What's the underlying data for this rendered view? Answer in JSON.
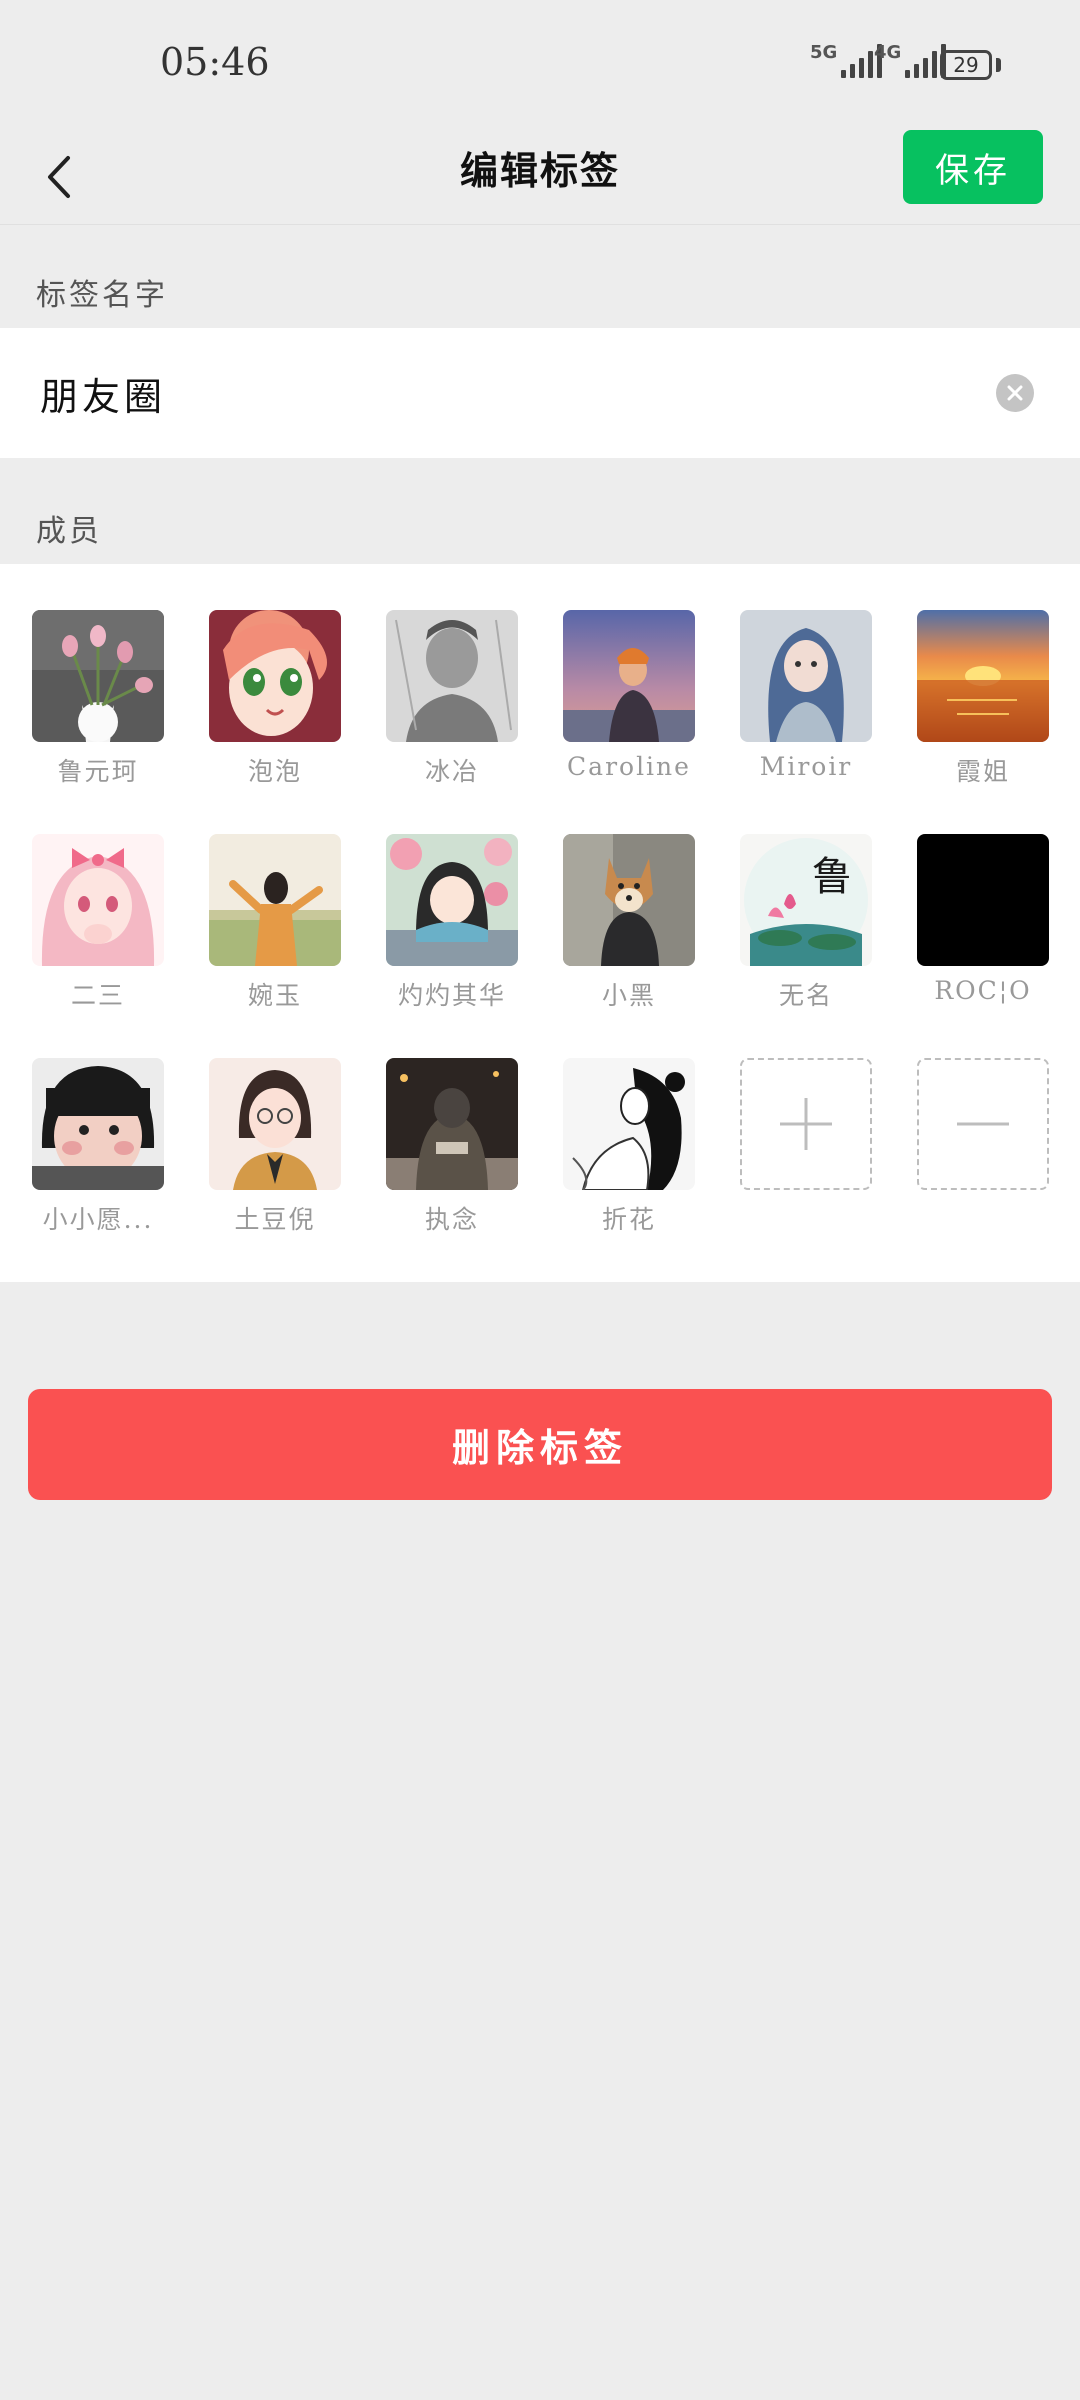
{
  "status_bar": {
    "time": "05:46",
    "sig1": "5G",
    "sig2": "4G",
    "battery": "29"
  },
  "nav": {
    "title": "编辑标签",
    "save_label": "保存"
  },
  "name_section": {
    "label": "标签名字",
    "value": "朋友圈"
  },
  "members_section": {
    "label": "成员"
  },
  "members": [
    {
      "name": "鲁元珂",
      "avatar_icon": "tulips-avatar"
    },
    {
      "name": "泡泡",
      "avatar_icon": "anime-girl-avatar"
    },
    {
      "name": "冰冶",
      "avatar_icon": "pencil-sketch-avatar"
    },
    {
      "name": "Caroline",
      "avatar_icon": "sunset-girl-avatar"
    },
    {
      "name": "Miroir",
      "avatar_icon": "blue-hair-girl-avatar"
    },
    {
      "name": "霞姐",
      "avatar_icon": "sea-sunset-avatar"
    },
    {
      "name": "二三",
      "avatar_icon": "pink-anime-avatar"
    },
    {
      "name": "婉玉",
      "avatar_icon": "field-girl-avatar"
    },
    {
      "name": "灼灼其华",
      "avatar_icon": "flower-girl-avatar"
    },
    {
      "name": "小黑",
      "avatar_icon": "shiba-avatar"
    },
    {
      "name": "无名",
      "avatar_icon": "lotus-lu-avatar"
    },
    {
      "name": "ROC¦O",
      "avatar_icon": "black-avatar"
    },
    {
      "name": "小小愿...",
      "avatar_icon": "baby-avatar"
    },
    {
      "name": "土豆倪",
      "avatar_icon": "cartoon-girl-avatar"
    },
    {
      "name": "执念",
      "avatar_icon": "hoodie-night-avatar"
    },
    {
      "name": "折花",
      "avatar_icon": "ink-girl-avatar"
    }
  ],
  "lu_char": "鲁",
  "delete_label": "删除标签",
  "colors": {
    "accent_green": "#07c160",
    "danger_red": "#fa5151",
    "bg": "#ededed"
  }
}
